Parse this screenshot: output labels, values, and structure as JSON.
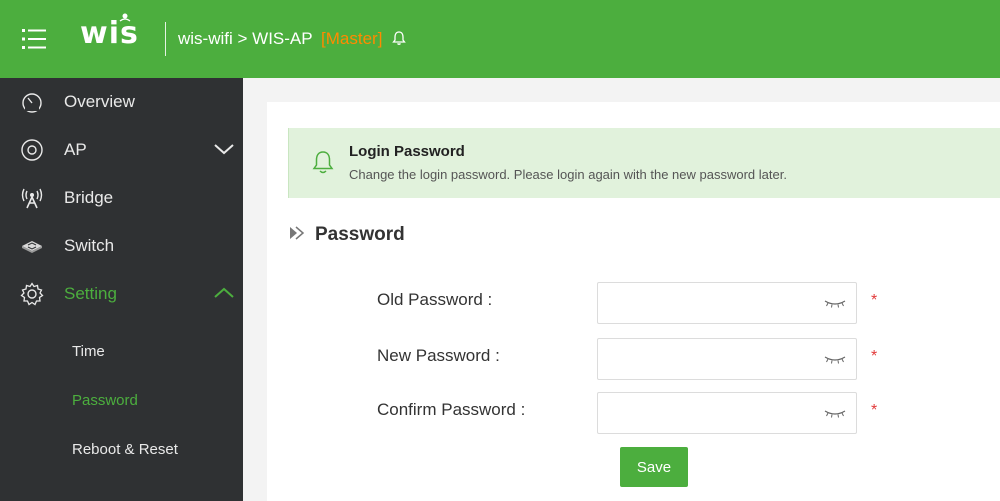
{
  "header": {
    "logo_text": "wis",
    "breadcrumb_site": "wis-wifi",
    "breadcrumb_sep": " > ",
    "breadcrumb_device": "WIS-AP",
    "breadcrumb_role": "[Master]"
  },
  "sidebar": {
    "items": [
      {
        "label": "Overview",
        "icon": "speedometer-icon"
      },
      {
        "label": "AP",
        "icon": "radio-icon"
      },
      {
        "label": "Bridge",
        "icon": "antenna-icon"
      },
      {
        "label": "Switch",
        "icon": "switch-icon"
      },
      {
        "label": "Setting",
        "icon": "gear-icon"
      }
    ],
    "sub_items": [
      {
        "label": "Time"
      },
      {
        "label": "Password"
      },
      {
        "label": "Reboot & Reset"
      }
    ]
  },
  "info": {
    "title": "Login Password",
    "description": "Change the login password. Please login again with the new password later."
  },
  "section": {
    "title": "Password"
  },
  "form": {
    "fields": [
      {
        "label": "Old Password :",
        "value": ""
      },
      {
        "label": "New Password :",
        "value": ""
      },
      {
        "label": "Confirm Password :",
        "value": ""
      }
    ],
    "required_mark": "*",
    "save_label": "Save"
  },
  "colors": {
    "brand": "#4cae3e",
    "sidebar_bg": "#2f3133",
    "master": "#ff8a00",
    "info_bg": "#e1f2dc",
    "required": "#e23a3a"
  }
}
